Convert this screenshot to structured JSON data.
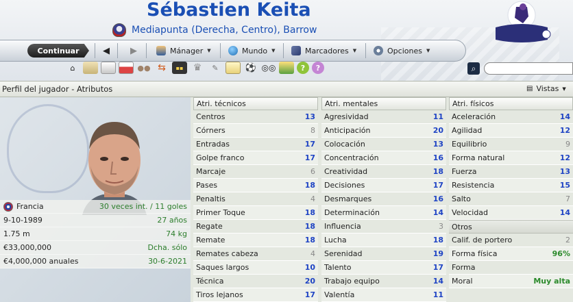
{
  "header": {
    "player_name": "Sébastien Keita",
    "subtitle": "Mediapunta (Derecha, Centro), Barrow"
  },
  "toolbar": {
    "continue_label": "Continuar",
    "menus": [
      {
        "label": "Mánager",
        "icon": "manager-icon"
      },
      {
        "label": "Mundo",
        "icon": "globe-icon"
      },
      {
        "label": "Marcadores",
        "icon": "bookmark-icon"
      },
      {
        "label": "Opciones",
        "icon": "options-icon"
      }
    ],
    "icons": [
      "home-icon",
      "stadium-icon",
      "inbox-icon",
      "calendar-icon",
      "squad-icon",
      "transfer-icon",
      "fixtures-icon",
      "trophy-icon",
      "tactics-icon",
      "notes-icon",
      "training-icon",
      "scout-icon",
      "finance-icon",
      "help-icon",
      "question-icon"
    ]
  },
  "search": {
    "placeholder": ""
  },
  "titlebar": {
    "title": "Perfil del jugador - Atributos",
    "views_label": "Vistas"
  },
  "player_info": {
    "nation": "Francia",
    "caps": "30 veces int. / 11 goles",
    "dob": "9-10-1989",
    "age": "27 años",
    "height": "1.75 m",
    "weight": "74 kg",
    "value": "€33,000,000",
    "foot": "Dcha. sólo",
    "wage": "€4,000,000 anuales",
    "contract": "30-6-2021"
  },
  "technical": {
    "title": "Atri. técnicos",
    "rows": [
      {
        "name": "Centros",
        "value": "13"
      },
      {
        "name": "Córners",
        "value": "8"
      },
      {
        "name": "Entradas",
        "value": "17"
      },
      {
        "name": "Golpe franco",
        "value": "17"
      },
      {
        "name": "Marcaje",
        "value": "6"
      },
      {
        "name": "Pases",
        "value": "18"
      },
      {
        "name": "Penaltis",
        "value": "4"
      },
      {
        "name": "Primer Toque",
        "value": "18"
      },
      {
        "name": "Regate",
        "value": "18"
      },
      {
        "name": "Remate",
        "value": "18"
      },
      {
        "name": "Remates cabeza",
        "value": "4"
      },
      {
        "name": "Saques largos",
        "value": "10"
      },
      {
        "name": "Técnica",
        "value": "20"
      },
      {
        "name": "Tiros lejanos",
        "value": "17"
      }
    ]
  },
  "mental": {
    "title": "Atri. mentales",
    "rows": [
      {
        "name": "Agresividad",
        "value": "11"
      },
      {
        "name": "Anticipación",
        "value": "20"
      },
      {
        "name": "Colocación",
        "value": "13"
      },
      {
        "name": "Concentración",
        "value": "16"
      },
      {
        "name": "Creatividad",
        "value": "18"
      },
      {
        "name": "Decisiones",
        "value": "17"
      },
      {
        "name": "Desmarques",
        "value": "16"
      },
      {
        "name": "Determinación",
        "value": "14"
      },
      {
        "name": "Influencia",
        "value": "3"
      },
      {
        "name": "Lucha",
        "value": "18"
      },
      {
        "name": "Serenidad",
        "value": "19"
      },
      {
        "name": "Talento",
        "value": "17"
      },
      {
        "name": "Trabajo equipo",
        "value": "14"
      },
      {
        "name": "Valentía",
        "value": "11"
      }
    ]
  },
  "physical": {
    "title": "Atri. físicos",
    "rows": [
      {
        "name": "Aceleración",
        "value": "14"
      },
      {
        "name": "Agilidad",
        "value": "12"
      },
      {
        "name": "Equilibrio",
        "value": "9"
      },
      {
        "name": "Forma natural",
        "value": "12"
      },
      {
        "name": "Fuerza",
        "value": "13"
      },
      {
        "name": "Resistencia",
        "value": "15"
      },
      {
        "name": "Salto",
        "value": "7"
      },
      {
        "name": "Velocidad",
        "value": "14"
      }
    ]
  },
  "others": {
    "title": "Otros",
    "rows": [
      {
        "name": "Calif. de portero",
        "value": "2"
      },
      {
        "name": "Forma física",
        "value": "96%"
      },
      {
        "name": "Forma",
        "value": ""
      },
      {
        "name": "Moral",
        "value": "Muy alta"
      }
    ]
  },
  "colors": {
    "name_blue": "#1a4fb4",
    "attr_high": "#1e43c4",
    "attr_low": "#888888",
    "positive_green": "#2b8a2b"
  }
}
